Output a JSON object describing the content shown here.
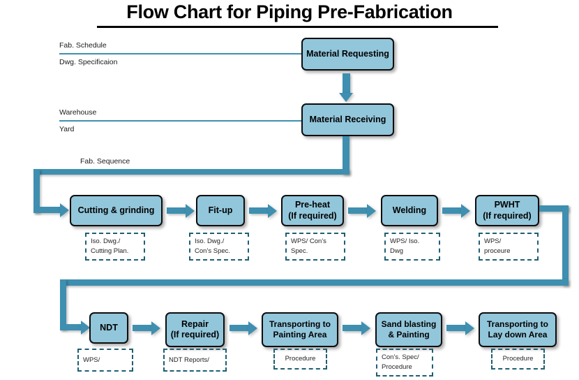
{
  "title": "Flow Chart for Piping Pre-Fabrication",
  "source_labels": [
    {
      "above": "Fab. Schedule",
      "below": "Dwg. Specificaion"
    },
    {
      "above": "Warehouse",
      "below": "Yard"
    }
  ],
  "sequence_label": "Fab. Sequence",
  "colors": {
    "box_fill": "#92C6DB",
    "box_border": "#0d0d0d",
    "connector": "#3E8FB0",
    "note_border": "#1F5F73",
    "title": "#000000"
  },
  "top_nodes": [
    {
      "label": "Material Requesting"
    },
    {
      "label": "Material Receiving"
    }
  ],
  "row1_nodes": [
    {
      "label": "Cutting & grinding",
      "note": [
        "Iso. Dwg./",
        "Cutting Plan."
      ]
    },
    {
      "label": "Fit-up",
      "note": [
        "Iso. Dwg./",
        "Con’s Spec."
      ]
    },
    {
      "label": "Pre-heat\n(If required)",
      "line1": "Pre-heat",
      "line2": "(If required)",
      "note": [
        "WPS/ Con's",
        "Spec."
      ]
    },
    {
      "label": "Welding",
      "note": [
        "WPS/ Iso.",
        "Dwg"
      ]
    },
    {
      "label": "PWHT\n(If required)",
      "line1": "PWHT",
      "line2": "(If required)",
      "note": [
        "WPS/",
        "proceure"
      ]
    }
  ],
  "row2_nodes": [
    {
      "label": "NDT",
      "note": [
        "WPS/"
      ]
    },
    {
      "label": "Repair\n(If required)",
      "line1": "Repair",
      "line2": "(If required)",
      "note": [
        "NDT Reports/"
      ]
    },
    {
      "label": "Transporting to\nPainting Area",
      "line1": "Transporting to",
      "line2": "Painting Area",
      "note": [
        "Procedure"
      ],
      "note_align": "center"
    },
    {
      "label": "Sand blasting\n& Painting",
      "line1": "Sand blasting",
      "line2": "& Painting",
      "note": [
        "Con’s. Spec/",
        "Procedure"
      ]
    },
    {
      "label": "Transporting to\nLay down Area",
      "line1": "Transporting to",
      "line2": "Lay down Area",
      "note": [
        "Procedure"
      ],
      "note_align": "center"
    }
  ]
}
